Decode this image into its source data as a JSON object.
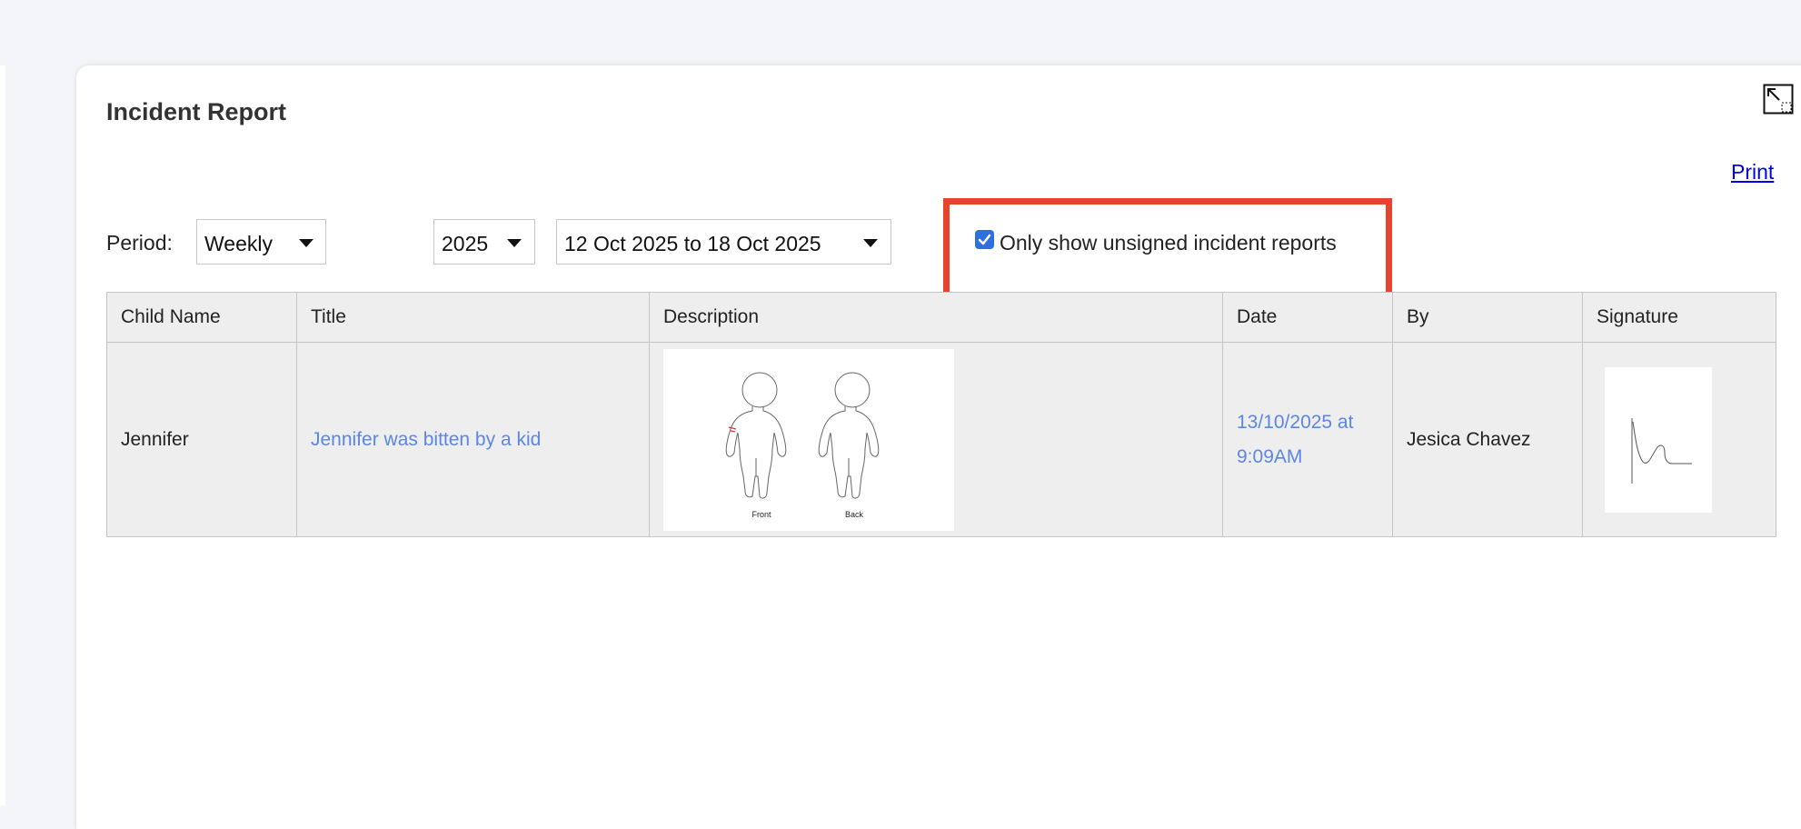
{
  "header": {
    "title": "Incident Report",
    "print_label": "Print"
  },
  "filters": {
    "period_label": "Period:",
    "period_value": "Weekly",
    "year_value": "2025",
    "range_value": "12 Oct 2025 to 18 Oct 2025",
    "unsigned_only_checked": true,
    "unsigned_only_label": "Only show unsigned incident reports",
    "highlight_color": "#e8432c"
  },
  "table": {
    "columns": [
      "Child Name",
      "Title",
      "Description",
      "Date",
      "By",
      "Signature"
    ],
    "rows": [
      {
        "child_name": "Jennifer",
        "title": "Jennifer was bitten by a kid",
        "description_image": {
          "front_label": "Front",
          "back_label": "Back"
        },
        "date_line1": "13/10/2025 at",
        "date_line2": "9:09AM",
        "by": "Jesica Chavez",
        "signature": "handwritten-signature-image"
      }
    ]
  },
  "icons": {
    "expand": "expand-icon",
    "dropdown": "caret-down-icon",
    "checkbox": "checkbox-checked-icon"
  },
  "colors": {
    "link": "#5b86e5",
    "print_link": "#0000ee",
    "checkbox": "#2f6fe0",
    "table_bg": "#eeeeee"
  }
}
